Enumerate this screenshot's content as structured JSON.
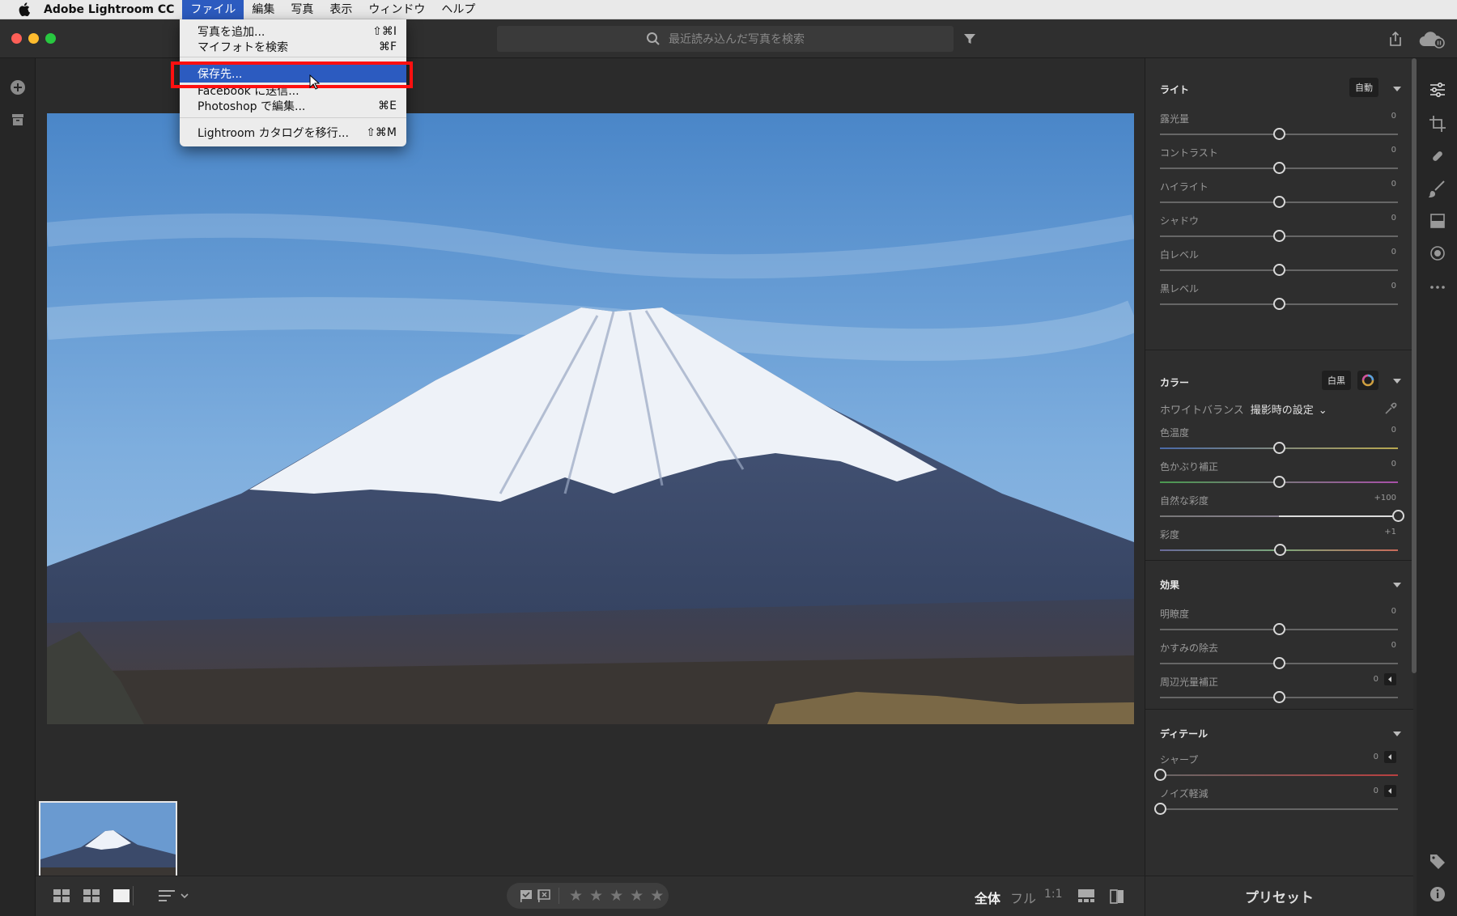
{
  "menubar": {
    "app_name": "Adobe Lightroom CC",
    "items": [
      "ファイル",
      "編集",
      "写真",
      "表示",
      "ウィンドウ",
      "ヘルプ"
    ]
  },
  "search": {
    "placeholder": "最近読み込んだ写真を検索"
  },
  "file_menu": {
    "items": [
      {
        "label": "写真を追加...",
        "shortcut": "⇧⌘I"
      },
      {
        "label": "マイフォトを検索",
        "shortcut": "⌘F"
      },
      {
        "label": "保存先...",
        "shortcut": ""
      },
      {
        "label": "Facebook に送信...",
        "shortcut": ""
      },
      {
        "label": "Photoshop で編集...",
        "shortcut": "⌘E"
      },
      {
        "label": "Lightroom カタログを移行...",
        "shortcut": "⇧⌘M"
      }
    ]
  },
  "light": {
    "title": "ライト",
    "auto_label": "自動",
    "sliders": [
      {
        "label": "露光量",
        "value": "0",
        "pos": 0.5
      },
      {
        "label": "コントラスト",
        "value": "0",
        "pos": 0.5
      },
      {
        "label": "ハイライト",
        "value": "0",
        "pos": 0.5
      },
      {
        "label": "シャドウ",
        "value": "0",
        "pos": 0.5
      },
      {
        "label": "白レベル",
        "value": "0",
        "pos": 0.5
      },
      {
        "label": "黒レベル",
        "value": "0",
        "pos": 0.5
      }
    ]
  },
  "color": {
    "title": "カラー",
    "bw_label": "白黒",
    "wb_label": "ホワイトバランス",
    "wb_value": "撮影時の設定",
    "sliders": [
      {
        "label": "色温度",
        "value": "0",
        "pos": 0.5
      },
      {
        "label": "色かぶり補正",
        "value": "0",
        "pos": 0.5
      },
      {
        "label": "自然な彩度",
        "value": "+100",
        "pos": 1.0
      },
      {
        "label": "彩度",
        "value": "+1",
        "pos": 0.505
      }
    ]
  },
  "effects": {
    "title": "効果",
    "sliders": [
      {
        "label": "明瞭度",
        "value": "0",
        "pos": 0.5
      },
      {
        "label": "かすみの除去",
        "value": "0",
        "pos": 0.5
      },
      {
        "label": "周辺光量補正",
        "value": "0",
        "pos": 0.5
      }
    ]
  },
  "detail": {
    "title": "ディテール",
    "sliders": [
      {
        "label": "シャープ",
        "value": "0",
        "pos": 0.0
      },
      {
        "label": "ノイズ軽減",
        "value": "0",
        "pos": 0.0
      }
    ]
  },
  "presets_label": "プリセット",
  "bottombar": {
    "zoom_fit": "全体",
    "zoom_fill": "フル",
    "zoom_1to1": "1:1",
    "stars": [
      "★",
      "★",
      "★",
      "★",
      "★"
    ]
  },
  "colors": {
    "accent": "#2c5bc0",
    "highlight_box": "#ff1010",
    "panel_bg": "#2e2e2e",
    "app_bg": "#2b2b2b"
  }
}
